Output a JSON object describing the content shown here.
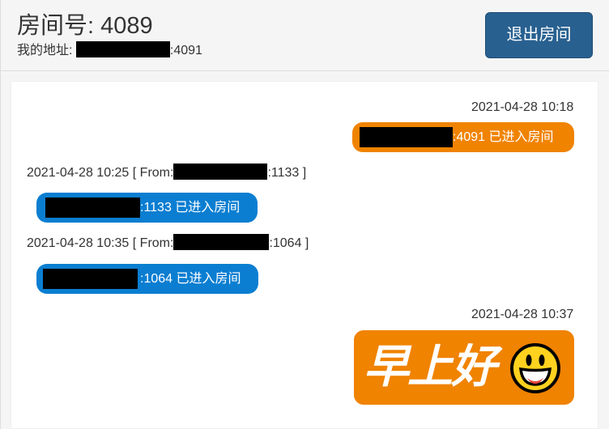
{
  "header": {
    "room_label": "房间号: 4089",
    "address_prefix": "我的地址: ",
    "address_port": ":4091",
    "exit_button": "退出房间"
  },
  "messages": [
    {
      "side": "right",
      "timestamp": "2021-04-28 10:18",
      "text": ":4091 已进入房间",
      "color": "#f08300"
    },
    {
      "side": "left",
      "timestamp": "2021-04-28 10:25 [ From:",
      "from_port": ":1133 ]",
      "text": ":1133 已进入房间",
      "color": "#0b7ed1"
    },
    {
      "side": "left",
      "timestamp": "2021-04-28 10:35 [ From:",
      "from_port": ":1064 ]",
      "text": ":1064 已进入房间",
      "color": "#0b7ed1"
    },
    {
      "side": "right",
      "timestamp": "2021-04-28 10:37",
      "sticker": "早上好",
      "sticker_icon": "smiley-face-icon",
      "color": "#f08300"
    }
  ]
}
